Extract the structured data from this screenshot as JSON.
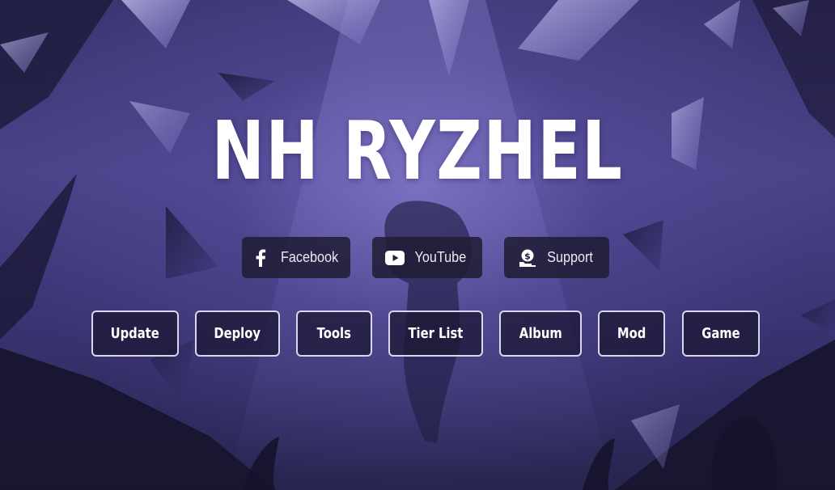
{
  "site": {
    "title": "NH RYZHEL"
  },
  "social_links": [
    {
      "label": "Facebook",
      "icon": "facebook-icon"
    },
    {
      "label": "YouTube",
      "icon": "youtube-icon"
    },
    {
      "label": "Support",
      "icon": "support-money-icon"
    }
  ],
  "nav_buttons": [
    {
      "label": "Update"
    },
    {
      "label": "Deploy"
    },
    {
      "label": "Tools"
    },
    {
      "label": "Tier List"
    },
    {
      "label": "Album"
    },
    {
      "label": "Mod"
    },
    {
      "label": "Game"
    }
  ],
  "colors": {
    "background": "#3a3470",
    "button_bg": "#201c34",
    "button_border": "#d9d6ee",
    "text": "#ffffff"
  }
}
